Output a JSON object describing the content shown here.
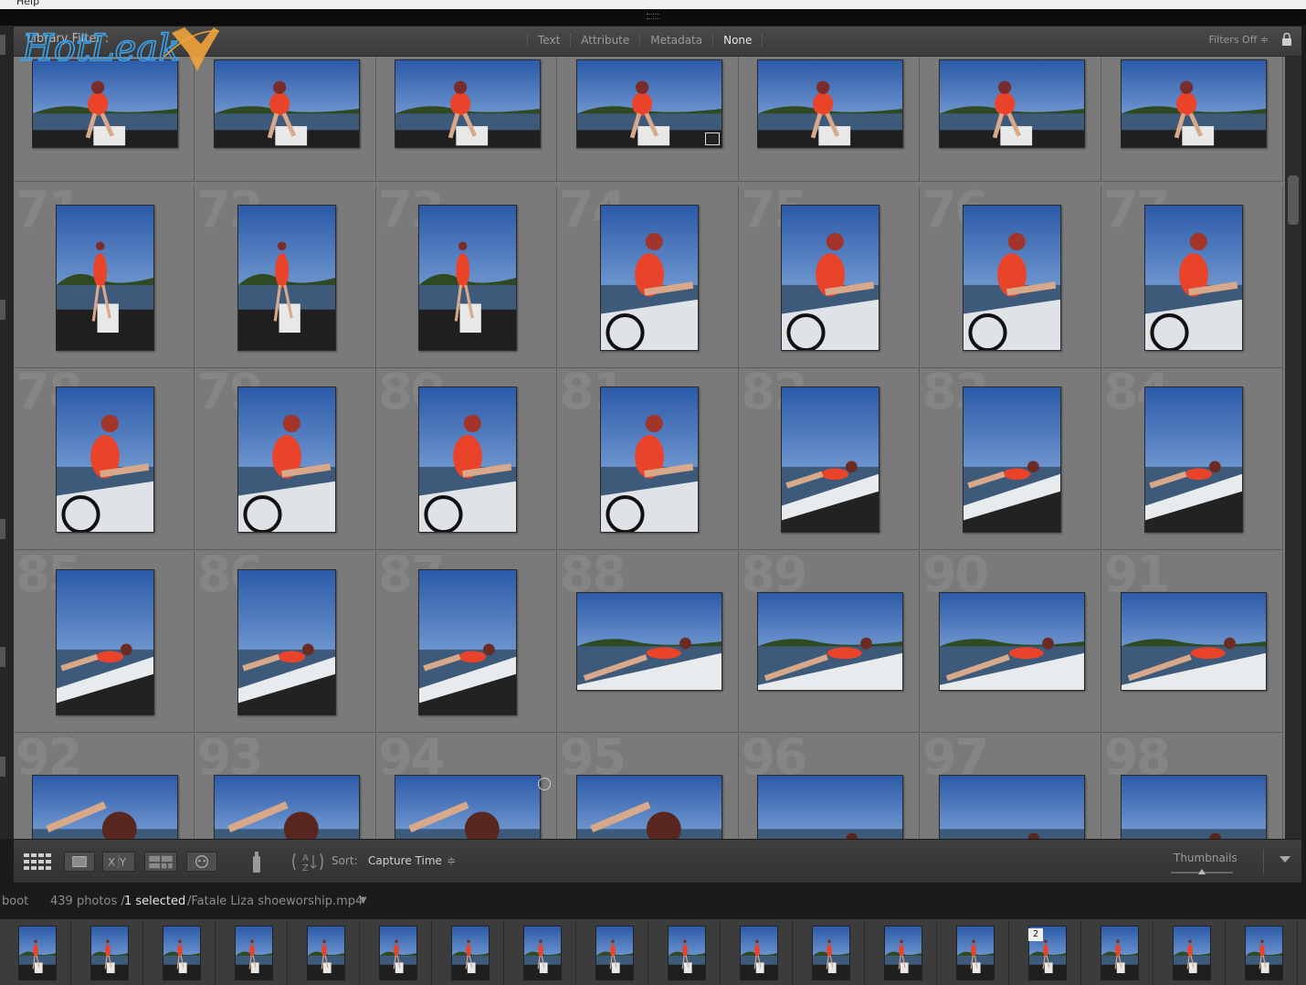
{
  "menubar": {
    "help_label": "Help"
  },
  "filter_bar": {
    "title": "Library Filter :",
    "options": [
      {
        "label": "Text",
        "active": false
      },
      {
        "label": "Attribute",
        "active": false
      },
      {
        "label": "Metadata",
        "active": false
      },
      {
        "label": "None",
        "active": true
      }
    ],
    "filters_status": "Filters Off ≑"
  },
  "watermark": {
    "text": "HotLeak"
  },
  "grid": {
    "rows": [
      {
        "numbers": [
          "",
          "",
          "",
          "",
          "",
          "",
          ""
        ],
        "orientations": [
          "land",
          "land",
          "land",
          "land",
          "land",
          "land",
          "land"
        ],
        "scene": [
          "boat-sit",
          "boat-sit",
          "boat-sit",
          "boat-sit",
          "boat-stand",
          "boat-stand",
          "boat-stand"
        ],
        "clipped_top": true
      },
      {
        "numbers": [
          "71",
          "72",
          "73",
          "74",
          "75",
          "76",
          "77"
        ],
        "orientations": [
          "port",
          "port",
          "port",
          "port",
          "port",
          "port",
          "port"
        ],
        "scene": [
          "boat-sit",
          "boat-sit",
          "boat-sit",
          "lean",
          "lean",
          "lean",
          "lean"
        ]
      },
      {
        "numbers": [
          "78",
          "79",
          "80",
          "81",
          "82",
          "83",
          "84"
        ],
        "orientations": [
          "port",
          "port",
          "port",
          "port",
          "port",
          "port",
          "port"
        ],
        "scene": [
          "lean",
          "lean",
          "lean",
          "lean",
          "lie-sky",
          "lie-sky",
          "lie-sky"
        ]
      },
      {
        "numbers": [
          "85",
          "86",
          "87",
          "88",
          "89",
          "90",
          "91"
        ],
        "orientations": [
          "port",
          "port",
          "port",
          "land",
          "land",
          "land",
          "land"
        ],
        "scene": [
          "lie-sky",
          "lie-sky",
          "lie-sky",
          "lie-trees",
          "lie-trees",
          "lie-trees",
          "lie-trees"
        ]
      },
      {
        "numbers": [
          "92",
          "93",
          "94",
          "95",
          "96",
          "97",
          "98"
        ],
        "orientations": [
          "land",
          "land",
          "land",
          "land",
          "land",
          "land",
          "land"
        ],
        "scene": [
          "close",
          "close",
          "close",
          "close",
          "lie-far",
          "lie-far",
          "lie-far"
        ]
      }
    ]
  },
  "toolbar": {
    "sort_label": "Sort:",
    "sort_value": "Capture Time",
    "sort_arrow": "≑",
    "thumbnail_label": "Thumbnails",
    "thumbnail_size": 0.5
  },
  "status": {
    "source": "boot",
    "count": "439 photos /",
    "selected": "1 selected",
    "path": "/Fatale Liza shoeworship.mp4"
  },
  "filmstrip": {
    "badge": "2",
    "items": 18
  },
  "colors": {
    "accent_orange": "#f2a33a",
    "sky": "#3f6fb8",
    "swimsuit": "#e9442a"
  }
}
